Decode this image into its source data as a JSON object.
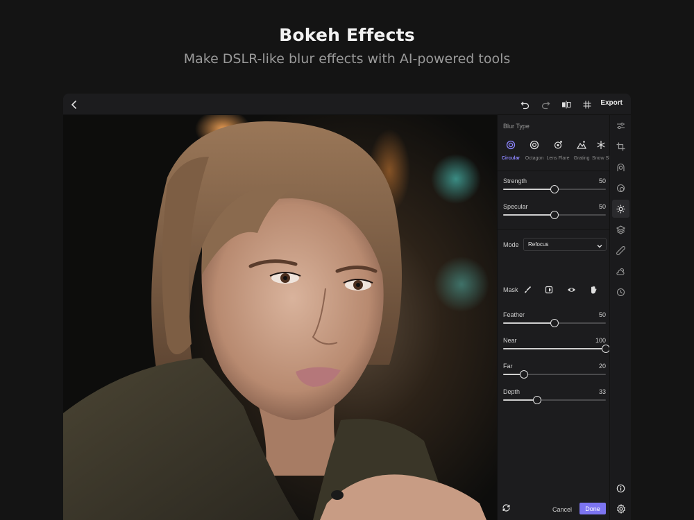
{
  "hero": {
    "title": "Bokeh Effects",
    "subtitle": "Make DSLR-like blur effects with AI-powered tools"
  },
  "topbar": {
    "icons": [
      "back-icon",
      "undo-icon",
      "redo-icon",
      "compare-icon",
      "grid-icon"
    ],
    "export_label": "Export"
  },
  "panel": {
    "blur_type_label": "Blur Type",
    "blur_types": [
      {
        "label": "Circular",
        "icon": "circle-icon",
        "active": true
      },
      {
        "label": "Octagon",
        "icon": "octagon-icon",
        "active": false
      },
      {
        "label": "Lens Flare",
        "icon": "lens-flare-icon",
        "active": false
      },
      {
        "label": "Grating",
        "icon": "grating-icon",
        "active": false
      },
      {
        "label": "Snow Sh",
        "icon": "snowflake-icon",
        "active": false
      }
    ],
    "strength": {
      "label": "Strength",
      "value": 50
    },
    "specular": {
      "label": "Specular",
      "value": 50
    },
    "mode_label": "Mode",
    "mode_value": "Refocus",
    "mask_label": "Mask",
    "mask_tools": [
      "brush-icon",
      "mask-invert-icon",
      "eye-icon",
      "hand-icon"
    ],
    "feather": {
      "label": "Feather",
      "value": 50
    },
    "near": {
      "label": "Near",
      "value": 100
    },
    "far": {
      "label": "Far",
      "value": 20
    },
    "depth": {
      "label": "Depth",
      "value": 33
    },
    "cancel_label": "Cancel",
    "done_label": "Done"
  },
  "rail": {
    "icons": [
      "adjust-icon",
      "crop-icon",
      "portrait-icon",
      "retouch-icon",
      "bokeh-icon",
      "layers-icon",
      "heal-icon",
      "weather-icon",
      "history-icon"
    ],
    "active_index": 4,
    "bottom_icons": [
      "info-icon",
      "settings-icon"
    ]
  },
  "colors": {
    "accent": "#7c74f0",
    "active_label": "#8d86ff",
    "background": "#141414",
    "panel": "#1c1c1e"
  }
}
